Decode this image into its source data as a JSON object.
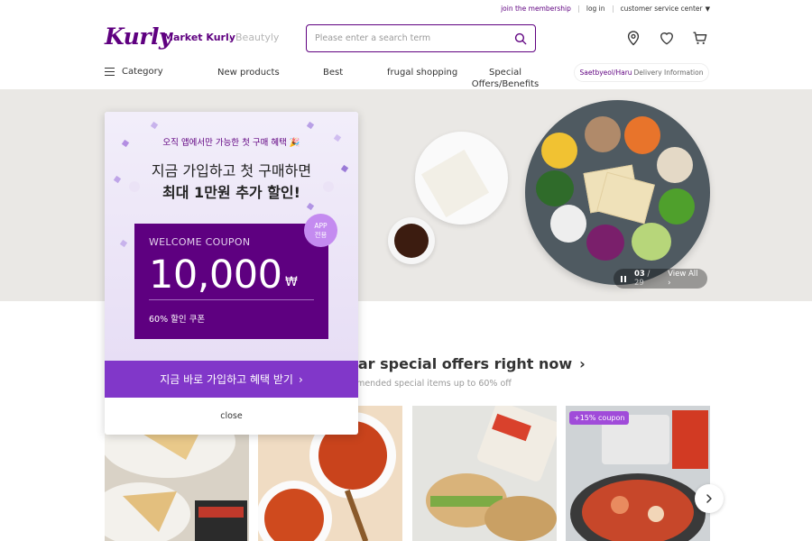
{
  "util_links": {
    "join": "join the membership",
    "login": "log in",
    "customer_service": "customer service center"
  },
  "header": {
    "logo": "Kurly",
    "market": "Market Kurly",
    "beauty": "Beautyly",
    "search": {
      "placeholder": "Please enter a search term",
      "value": ""
    },
    "icons": [
      "location-icon",
      "heart-icon",
      "cart-icon"
    ]
  },
  "nav": {
    "category": "Category",
    "items": [
      "New products",
      "Best",
      "frugal shopping",
      "Special Offers/Benefits"
    ],
    "delivery_highlight": "Saetbyeol/Haru",
    "delivery_rest": "Delivery Information"
  },
  "banner": {
    "current_slide": "03",
    "total_slides": "29",
    "view_all": "View All"
  },
  "popup": {
    "kicker": "오직 앱에서만 가능한 첫 구매 혜택 🎉",
    "headline_1": "지금 가입하고 첫 구매하면",
    "headline_2": "최대 1만원 추가 할인!",
    "coupon_label": "WELCOME COUPON",
    "coupon_amount": "10,000",
    "coupon_currency": "₩",
    "coupon_desc": "60% 할인 쿠폰",
    "badge_line1": "APP",
    "badge_line2": "전용",
    "cta": "지금 바로 가입하고 혜택 받기",
    "close": "close"
  },
  "section": {
    "title": "ular special offers right now",
    "subtitle": "ommended special items up to 60% off"
  },
  "products": [
    {
      "tag": "",
      "image": "quesadilla"
    },
    {
      "tag": "",
      "image": "spicy-soup"
    },
    {
      "tag": "",
      "image": "sandwich"
    },
    {
      "tag": "+15% coupon",
      "image": "seafood-stew"
    }
  ],
  "colors": {
    "brand_purple": "#5f0080",
    "cta_purple": "#8137c9",
    "coupon_purple": "#5e0080"
  }
}
